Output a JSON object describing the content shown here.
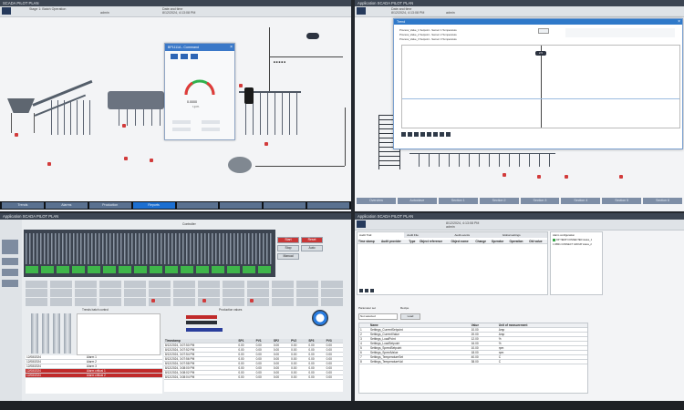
{
  "left_top": {
    "title": "SCADA PILOT PLAN",
    "header": {
      "a": "Stage 1: Batch Operation",
      "b": "Time",
      "c": "admin",
      "d": "Date and time",
      "e": "8/12/2024, 4:13:08 PM"
    },
    "faceplate": {
      "title": "BP1111A - Command",
      "gauge_value": "0.0000",
      "unit": "r.p.m."
    },
    "nav": [
      "Trends",
      "Alarms",
      "Production",
      "Reports",
      "",
      "",
      "",
      ""
    ]
  },
  "right_top": {
    "title": "Application SCADA PILOT PLAN",
    "header": {
      "b": "Date and time",
      "e": "8/12/2024, 4:13:08 PM",
      "c": "admin"
    },
    "trend": {
      "title": "Trend",
      "series": [
        "Process_Value_1 Setpoint - Sensor 1 Temperature",
        "Process_Value_2 Setpoint - Sensor 2 Temperature",
        "Process_Value_3 Setpoint - Sensor 3 Temperature"
      ],
      "ctrl_value": "2.5"
    },
    "nav": [
      "Overview",
      "Autoclave",
      "Section 1",
      "Section 2",
      "Section 3",
      "Section 4",
      "Section 5",
      "Section 6"
    ]
  },
  "left_bottom": {
    "title": "Application SCADA PILOT PLAN",
    "section": "Controller",
    "buttons_right": [
      "Start",
      "Reset",
      "Stop",
      "Auto",
      "Manual"
    ],
    "trends_title": "Trends batch control",
    "values_title": "Production values",
    "table_headers": [
      "Timestamp",
      "SP1",
      "PV1",
      "SP2",
      "PV2",
      "SP3",
      "PV3"
    ],
    "table_rows": [
      [
        "8/12/2024, 3:07:50 PM",
        "0.00",
        "0.00",
        "0.00",
        "0.00",
        "0.00",
        "0.00"
      ],
      [
        "8/12/2024, 3:07:52 PM",
        "0.00",
        "0.00",
        "0.00",
        "0.00",
        "0.00",
        "0.00"
      ],
      [
        "8/12/2024, 3:07:54 PM",
        "0.00",
        "0.00",
        "0.00",
        "0.00",
        "0.00",
        "0.00"
      ],
      [
        "8/12/2024, 3:07:56 PM",
        "0.00",
        "0.00",
        "0.00",
        "0.00",
        "0.00",
        "0.00"
      ],
      [
        "8/12/2024, 3:07:58 PM",
        "0.00",
        "0.00",
        "0.00",
        "0.00",
        "0.00",
        "0.00"
      ],
      [
        "8/12/2024, 3:08:00 PM",
        "0.00",
        "0.00",
        "0.00",
        "0.00",
        "0.00",
        "0.00"
      ],
      [
        "8/12/2024, 3:08:02 PM",
        "0.00",
        "0.00",
        "0.00",
        "0.00",
        "0.00",
        "0.00"
      ],
      [
        "8/12/2024, 3:08:04 PM",
        "0.00",
        "0.00",
        "0.00",
        "0.00",
        "0.00",
        "0.00"
      ]
    ],
    "alarm_rows": [
      [
        "12/08/2024",
        "Alarm 1"
      ],
      [
        "12/08/2024",
        "Alarm 2"
      ],
      [
        "12/08/2024",
        "Alarm 3"
      ]
    ],
    "red_rows": [
      [
        "12/08/2024",
        "Alarm critical 1"
      ],
      [
        "12/08/2024",
        "Alarm critical 2"
      ]
    ]
  },
  "right_bottom": {
    "title": "Application SCADA PILOT PLAN",
    "header": {
      "e": "8/12/2024, 4:13:08 PM",
      "c": "admin"
    },
    "tabs": [
      "Audit Trail",
      "Audit File",
      "Audit events",
      "Global settings"
    ],
    "audit_headers": [
      "Time stamp",
      "Audit provider",
      "Type",
      "Object reference",
      "Object name",
      "Change",
      "Operator",
      "Operation",
      "Old value"
    ],
    "audit_side_title": "Alarm configuration",
    "audit_side_items": [
      "DP TEMP CONNECTED status_1",
      "1 DB01 CONNECT GROUP status_2"
    ],
    "settings_labels": {
      "l1": "Parameter set",
      "l2": "Recipe",
      "l3": "Not selected",
      "l4": "Load"
    },
    "settings_headers": [
      "",
      "Name",
      "Value",
      "Unit of measurement"
    ],
    "settings_rows": [
      [
        "1",
        "Settings_CurrentSetpoint",
        "10.00",
        "Amp"
      ],
      [
        "2",
        "Settings_CurrentValue",
        "20.00",
        "Amp"
      ],
      [
        "3",
        "Settings_LoadPoint",
        "12.00",
        "%"
      ],
      [
        "4",
        "Settings_LoadSetpoint",
        "16.00",
        "%"
      ],
      [
        "5",
        "Settings_SpeedSetpoint",
        "10.00",
        "rpm"
      ],
      [
        "6",
        "Settings_SpeedValue",
        "18.00",
        "rpm"
      ],
      [
        "7",
        "Settings_TemperatureSet",
        "40.00",
        "C"
      ],
      [
        "8",
        "Settings_TemperatureVal",
        "38.00",
        "C"
      ]
    ]
  }
}
